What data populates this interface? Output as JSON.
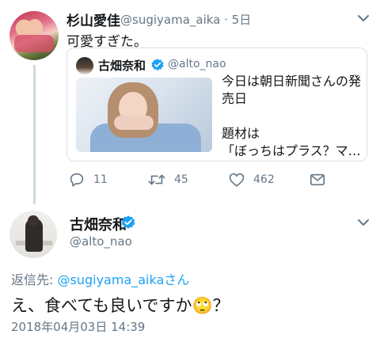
{
  "tweet1": {
    "name": "杉山愛佳",
    "handle_time": "@sugiyama_aika · 5日",
    "text": "可愛すぎた。",
    "quote": {
      "name": "古畑奈和",
      "handle": "@alto_nao",
      "text_lines": [
        "今日は朝日新聞さんの発",
        "売日",
        "",
        "題材は",
        "「ぼっちはプラス？マ…"
      ]
    },
    "actions": {
      "reply_count": "11",
      "retweet_count": "45",
      "like_count": "462"
    }
  },
  "tweet2": {
    "name": "古畑奈和",
    "handle": "@alto_nao",
    "reply_prefix": "返信先: ",
    "reply_handle": "@sugiyama_aikaさん",
    "text": "え、食べても良いですか",
    "emoji": "🙄",
    "text_suffix": "？",
    "timestamp": "2018年04月03日 14:39"
  },
  "colors": {
    "accent": "#1da1f2",
    "muted": "#657786",
    "text": "#14171a",
    "border": "#d8dfe4"
  },
  "icons": {
    "reply": "reply-icon",
    "retweet": "retweet-icon",
    "like": "heart-icon",
    "dm": "envelope-icon",
    "menu": "chevron-down-icon",
    "verified": "verified-badge-icon"
  }
}
